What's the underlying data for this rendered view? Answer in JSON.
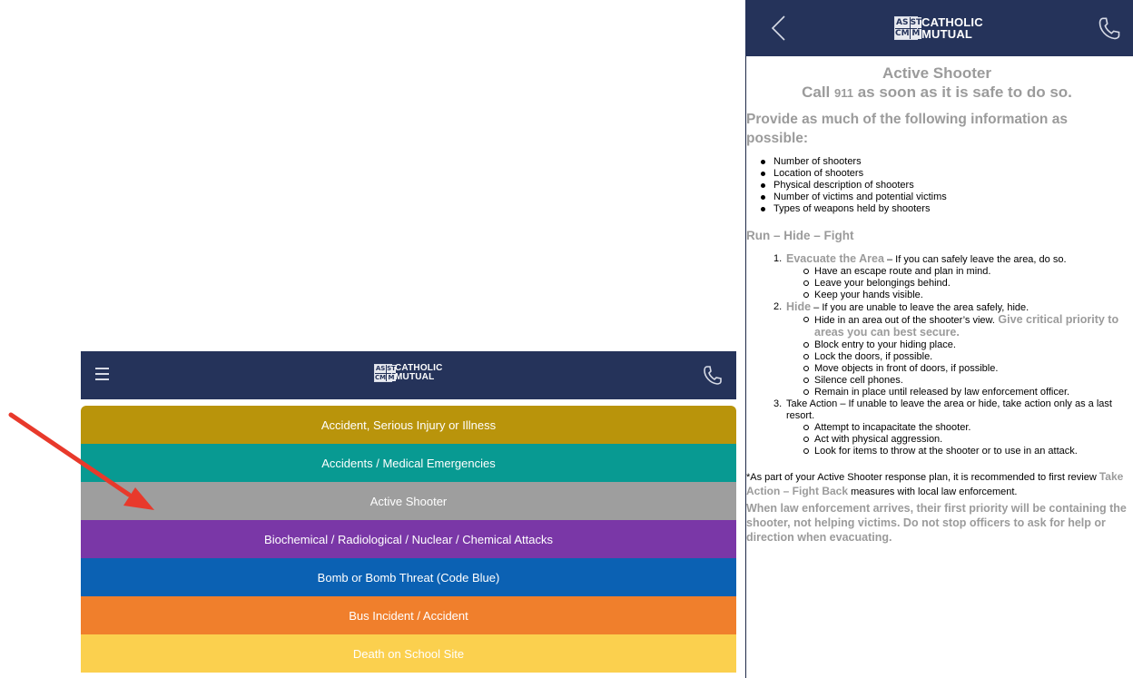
{
  "left_screen": {
    "logo": {
      "mark": [
        "AS",
        "ST",
        "CM",
        "M"
      ],
      "line1": "CATHOLIC",
      "line2": "MUTUAL"
    },
    "menu_items": [
      {
        "label": "Accident, Serious Injury or Illness",
        "color": "#b9940b"
      },
      {
        "label": "Accidents / Medical Emergencies",
        "color": "#089a92"
      },
      {
        "label": "Active Shooter",
        "color": "#9e9e9e"
      },
      {
        "label": "Biochemical / Radiological / Nuclear / Chemical Attacks",
        "color": "#7a37a7"
      },
      {
        "label": "Bomb or Bomb Threat (Code Blue)",
        "color": "#0b61b3"
      },
      {
        "label": "Bus Incident / Accident",
        "color": "#f07f2c"
      },
      {
        "label": "Death on School Site",
        "color": "#fbd04e"
      }
    ]
  },
  "annotation": {
    "arrow_color": "#e8392b"
  },
  "right_screen": {
    "logo": {
      "mark": [
        "AS",
        "ST",
        "CM",
        "M"
      ],
      "line1": "CATHOLIC",
      "line2": "MUTUAL"
    },
    "title": "Active Shooter",
    "call_pre": "Call ",
    "call_num": "911",
    "call_post": " as soon as it is safe to do so.",
    "lead": "Provide as much of the following information as possible:",
    "bullets": [
      "Number of shooters",
      "Location of shooters",
      "Physical description of shooters",
      "Number of victims and potential victims",
      "Types of weapons held by shooters"
    ],
    "section_heading": "Run – Hide – Fight",
    "steps": [
      {
        "num": "1.",
        "highlight": "Evacuate the Area",
        "text": " – If you can safely leave the area, do so.",
        "subs": [
          "Have an escape route and plan in mind.",
          "Leave your belongings behind.",
          "Keep your hands visible."
        ]
      },
      {
        "num": "2.",
        "highlight": "Hide",
        "text": " – If you are unable to leave the area safely, hide.",
        "first_sub": "Hide in an area out of the shooter’s view.",
        "first_sub_highlight": " Give critical priority to areas you can best secure.",
        "subs": [
          "Block entry to your hiding place.",
          "Lock the doors, if possible.",
          "Move objects in front of doors, if possible.",
          "Silence cell phones.",
          "Remain in place until released by law enforcement officer."
        ]
      },
      {
        "num": "3.",
        "text": "Take Action – If unable to leave the area or hide, take action only as a last resort.",
        "subs": [
          "Attempt to incapacitate the shooter.",
          "Act with physical aggression.",
          "Look for items to throw at the shooter or to use in an attack."
        ]
      }
    ],
    "note_pre": "*As part of your Active Shooter response plan, it is recommended to first review ",
    "note_highlight": "Take Action – Fight Back",
    "note_post": " measures with local law enforcement.",
    "warning": "When law enforcement arrives, their first priority will be containing the shooter, not helping victims. Do not stop officers to ask for help or direction when evacuating."
  }
}
